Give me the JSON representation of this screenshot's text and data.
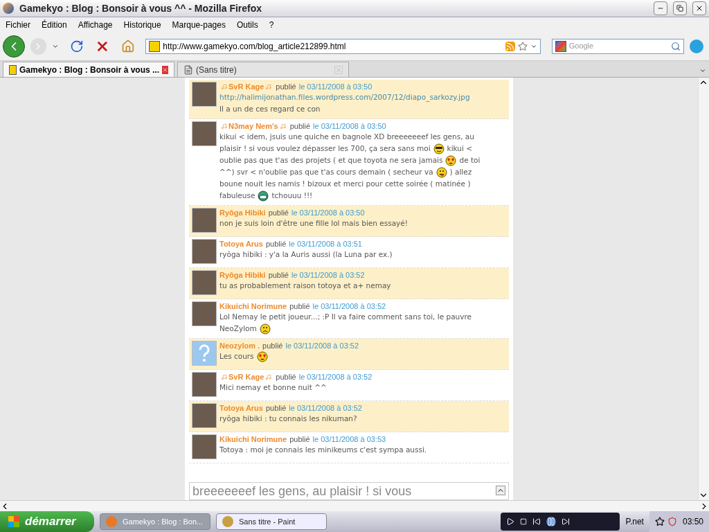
{
  "window": {
    "title": "Gamekyo : Blog : Bonsoir à vous ^^ - Mozilla Firefox"
  },
  "menu": [
    "Fichier",
    "Édition",
    "Affichage",
    "Historique",
    "Marque-pages",
    "Outils",
    "?"
  ],
  "address": {
    "value": "http://www.gamekyo.com/blog_article212899.html"
  },
  "search": {
    "placeholder": "Google"
  },
  "tabs": [
    {
      "label": "Gamekyo : Blog : Bonsoir à vous ...",
      "selected": true
    },
    {
      "label": "(Sans titre)",
      "selected": false
    }
  ],
  "comments": [
    {
      "author": "SvR Kage",
      "decorated": true,
      "default_avatar": false,
      "highlighted": true,
      "verb": "publié",
      "date": "le 03/11/2008 à 03:50",
      "link": "http://halimijonathan.files.wordpress.com/2007/12/diapo_sarkozy.jpg",
      "lines": [
        [
          {
            "kind": "text",
            "text": "Il a un de ces regard ce con"
          }
        ]
      ]
    },
    {
      "author": "N3may Nem's",
      "decorated": true,
      "default_avatar": false,
      "highlighted": false,
      "verb": "publié",
      "date": "le 03/11/2008 à 03:50",
      "lines": [
        [
          {
            "kind": "text",
            "text": "kikui < idem, jsuis une quiche en bagnole XD breeeeeeef les gens, au"
          }
        ],
        [
          {
            "kind": "text",
            "text": "plaisir ! si vous voulez dépasser les 700, ça sera sans moi"
          },
          {
            "kind": "cool"
          },
          {
            "kind": "text",
            "text": "kikui <"
          }
        ],
        [
          {
            "kind": "text",
            "text": "oublie pas que t'as des projets ( et que toyota ne sera jamais"
          },
          {
            "kind": "love"
          },
          {
            "kind": "text",
            "text": "de toi"
          }
        ],
        [
          {
            "kind": "text",
            "text": "^^) svr < n'oublie pas que t'as cours demain ( secheur va"
          },
          {
            "kind": "tongue"
          },
          {
            "kind": "text",
            "text": ") allez"
          }
        ],
        [
          {
            "kind": "text",
            "text": "boune nouit les namis ! bizoux et merci pour cette soirée ( matinée )"
          }
        ],
        [
          {
            "kind": "text",
            "text": "fabuleuse"
          },
          {
            "kind": "grin"
          },
          {
            "kind": "text",
            "text": "tchouuu !!!"
          }
        ]
      ]
    },
    {
      "author": "Ryôga Hibiki",
      "decorated": false,
      "default_avatar": false,
      "highlighted": true,
      "verb": "publié",
      "date": "le 03/11/2008 à 03:50",
      "lines": [
        [
          {
            "kind": "text",
            "text": "non je suis loin d'être une fille lol mais bien essayé!"
          }
        ]
      ]
    },
    {
      "author": "Totoya Arus",
      "decorated": false,
      "default_avatar": false,
      "highlighted": false,
      "verb": "publié",
      "date": "le 03/11/2008 à 03:51",
      "lines": [
        [
          {
            "kind": "text",
            "text": "ryôga hibiki : y'a la Auris aussi (la Luna par ex.)"
          }
        ]
      ]
    },
    {
      "author": "Ryôga Hibiki",
      "decorated": false,
      "default_avatar": false,
      "highlighted": true,
      "verb": "publié",
      "date": "le 03/11/2008 à 03:52",
      "lines": [
        [
          {
            "kind": "text",
            "text": "tu as probablement raison totoya et a+ nemay"
          }
        ]
      ]
    },
    {
      "author": "Kikuichi Norimune",
      "decorated": false,
      "default_avatar": false,
      "highlighted": false,
      "verb": "publié",
      "date": "le 03/11/2008 à 03:52",
      "lines": [
        [
          {
            "kind": "text",
            "text": "Lol Nemay le petit joueur...; :P Il va faire comment sans toi, le pauvre"
          }
        ],
        [
          {
            "kind": "text",
            "text": "NeoZylom"
          },
          {
            "kind": "sad"
          }
        ]
      ]
    },
    {
      "author": "Neozylom .",
      "decorated": false,
      "default_avatar": true,
      "highlighted": true,
      "verb": "publié",
      "date": "le 03/11/2008 à 03:52",
      "lines": [
        [
          {
            "kind": "text",
            "text": "Les cours"
          },
          {
            "kind": "love"
          }
        ]
      ]
    },
    {
      "author": "SvR Kage",
      "decorated": true,
      "default_avatar": false,
      "highlighted": false,
      "verb": "publié",
      "date": "le 03/11/2008 à 03:52",
      "lines": [
        [
          {
            "kind": "text",
            "text": "Mici nemay et bonne nuit ^^"
          }
        ]
      ]
    },
    {
      "author": "Totoya Arus",
      "decorated": false,
      "default_avatar": false,
      "highlighted": true,
      "verb": "publié",
      "date": "le 03/11/2008 à 03:52",
      "lines": [
        [
          {
            "kind": "text",
            "text": "ryôga hibiki : tu connais les nikuman?"
          }
        ]
      ]
    },
    {
      "author": "Kikuichi Norimune",
      "decorated": false,
      "default_avatar": false,
      "highlighted": false,
      "verb": "publié",
      "date": "le 03/11/2008 à 03:53",
      "lines": [
        [
          {
            "kind": "text",
            "text": "Totoya : moi je connais les minikeums c'est sympa aussi."
          }
        ]
      ]
    }
  ],
  "reply_box": {
    "value": "breeeeeeef les gens, au plaisir ! si vous"
  },
  "taskbar": {
    "start": "démarrer",
    "tasks": [
      {
        "label": "Gamekyo : Blog : Bon...",
        "selected": true
      },
      {
        "label": "Sans titre - Paint",
        "selected": false
      }
    ],
    "toolbar_label": "P.net",
    "clock": "03:50"
  }
}
